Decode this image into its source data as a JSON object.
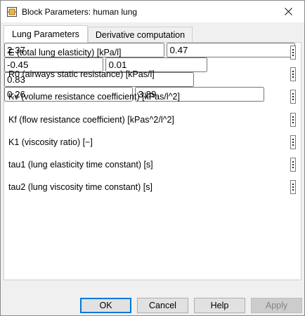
{
  "window": {
    "title": "Block Parameters: human lung",
    "icon": "block-icon"
  },
  "tabs": [
    {
      "label": "Lung Parameters",
      "active": true
    },
    {
      "label": "Derivative computation",
      "active": false
    }
  ],
  "params": [
    {
      "label": "E (total lung elasticity) [kPa/l]",
      "value": "2.37"
    },
    {
      "label": "R0 (airways static resistance) [kPas/l]",
      "value": "0.47"
    },
    {
      "label": "Kv (volume resistance coefficient) [kPas/l^2]",
      "value": "-0.45"
    },
    {
      "label": "Kf (flow resistance coefficient) [kPas^2/l^2]",
      "value": "0.01"
    },
    {
      "label": "K1 (viscosity ratio) [−]",
      "value": "0.83"
    },
    {
      "label": "tau1 (lung elasticity time constant) [s]",
      "value": "0.26"
    },
    {
      "label": "tau2 (lung viscosity time constant) [s]",
      "value": "3.89"
    }
  ],
  "buttons": {
    "ok": "OK",
    "cancel": "Cancel",
    "help": "Help",
    "apply": "Apply"
  },
  "colors": {
    "accent": "#0078d7",
    "panel": "#ffffff",
    "background": "#f0f0f0"
  }
}
